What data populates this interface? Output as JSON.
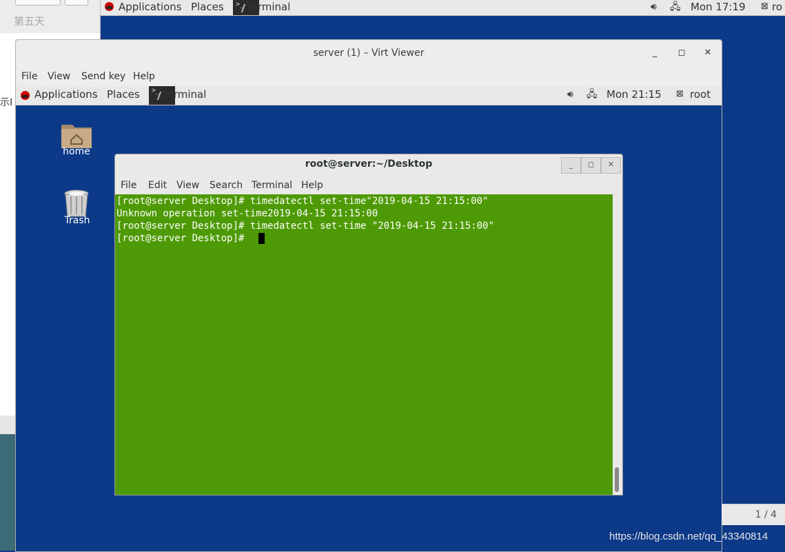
{
  "host_panel": {
    "applications": "Applications",
    "places": "Places",
    "terminal": "Terminal",
    "clock": "Mon 17:19",
    "user": "ro"
  },
  "left_window": {
    "tab_title": "第五天",
    "fragment": "示Ⅰ"
  },
  "virt_viewer": {
    "title": "server (1) – Virt Viewer",
    "menu": [
      "File",
      "View",
      "Send key",
      "Help"
    ],
    "controls": {
      "minimize": "_",
      "maximize": "◻",
      "close": "✕"
    }
  },
  "guest_panel": {
    "applications": "Applications",
    "places": "Places",
    "terminal": "Terminal",
    "clock": "Mon 21:15",
    "user": "root"
  },
  "desktop_icons": [
    {
      "label": "home",
      "icon": "home-folder-icon"
    },
    {
      "label": "Trash",
      "icon": "trash-icon"
    }
  ],
  "terminal": {
    "title": "root@server:~/Desktop",
    "menu": [
      "File",
      "Edit",
      "View",
      "Search",
      "Terminal",
      "Help"
    ],
    "lines": [
      "[root@server Desktop]# timedatectl set-time\"2019-04-15 21:15:00\"",
      "Unknown operation set-time2019-04-15 21:15:00",
      "[root@server Desktop]# timedatectl set-time \"2019-04-15 21:15:00\"",
      "[root@server Desktop]# "
    ],
    "background_color": "#4e9a06"
  },
  "page_indicator": "1 / 4",
  "watermark": "https://blog.csdn.net/qq_43340814",
  "colors": {
    "desktop": "#0d3a88",
    "panel": "#e8e8e7",
    "terminal_bg": "#4e9a06"
  }
}
